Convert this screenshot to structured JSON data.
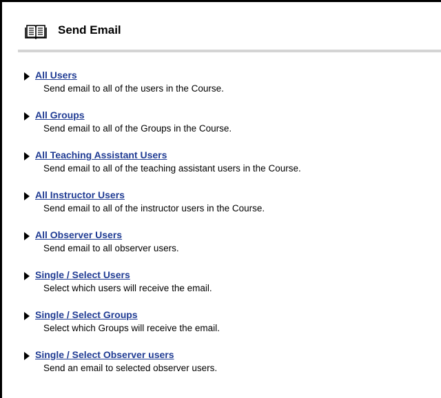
{
  "header": {
    "title": "Send Email",
    "icon": "book-icon"
  },
  "colors": {
    "link": "#1f3b93",
    "divider": "#d4d4d4",
    "border": "#000000"
  },
  "options": [
    {
      "label": "All Users",
      "description": "Send email to all of the users in the Course."
    },
    {
      "label": "All Groups",
      "description": "Send email to all of the Groups in the Course."
    },
    {
      "label": "All Teaching Assistant Users",
      "description": "Send email to all of the teaching assistant users in the Course."
    },
    {
      "label": "All Instructor Users",
      "description": "Send email to all of the instructor users in the Course."
    },
    {
      "label": "All Observer Users",
      "description": "Send email to all observer users."
    },
    {
      "label": "Single / Select Users",
      "description": "Select which users will receive the email."
    },
    {
      "label": "Single / Select Groups",
      "description": "Select which Groups will receive the email."
    },
    {
      "label": "Single / Select Observer users",
      "description": "Send an email to selected observer users."
    }
  ]
}
